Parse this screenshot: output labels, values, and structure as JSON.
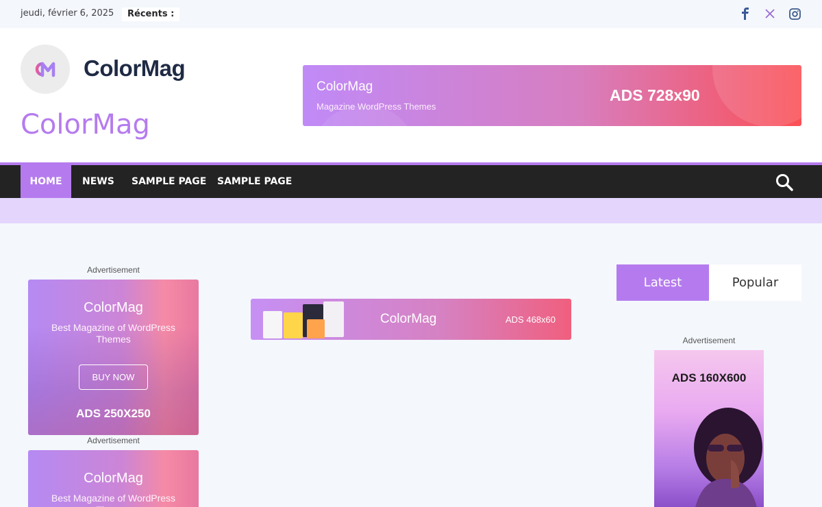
{
  "topbar": {
    "date": "jeudi, février 6, 2025",
    "recents_label": "Récents :",
    "social": [
      "facebook-icon",
      "x-icon",
      "instagram-icon"
    ]
  },
  "header": {
    "logo_mark": "CM",
    "logo_name": "ColorMag",
    "site_title": "ColorMag",
    "banner": {
      "brand": "ColorMag",
      "subtitle": "Magazine WordPress Themes",
      "size": "ADS 728x90"
    }
  },
  "nav": {
    "items": [
      {
        "label": "HOME",
        "active": true
      },
      {
        "label": "NEWS",
        "active": false
      },
      {
        "label": "SAMPLE PAGE",
        "active": false
      },
      {
        "label": "SAMPLE PAGE",
        "active": false
      }
    ],
    "search_icon": "search-icon"
  },
  "left_ads": [
    {
      "label": "Advertisement",
      "brand": "ColorMag",
      "subtitle": "Best Magazine of WordPress Themes",
      "button": "BUY NOW",
      "size": "ADS 250X250"
    },
    {
      "label": "Advertisement",
      "brand": "ColorMag",
      "subtitle": "Best Magazine of WordPress Themes"
    }
  ],
  "center_ad": {
    "brand": "ColorMag",
    "size": "ADS 468x60"
  },
  "sidebar": {
    "tabs": {
      "latest": "Latest",
      "popular": "Popular"
    },
    "ad_label": "Advertisement",
    "ad_size": "ADS 160X600"
  },
  "colors": {
    "accent": "#b57bee",
    "nav_bg": "#232323",
    "band": "#e4d5fd",
    "page_bg": "#f4f7fc"
  }
}
